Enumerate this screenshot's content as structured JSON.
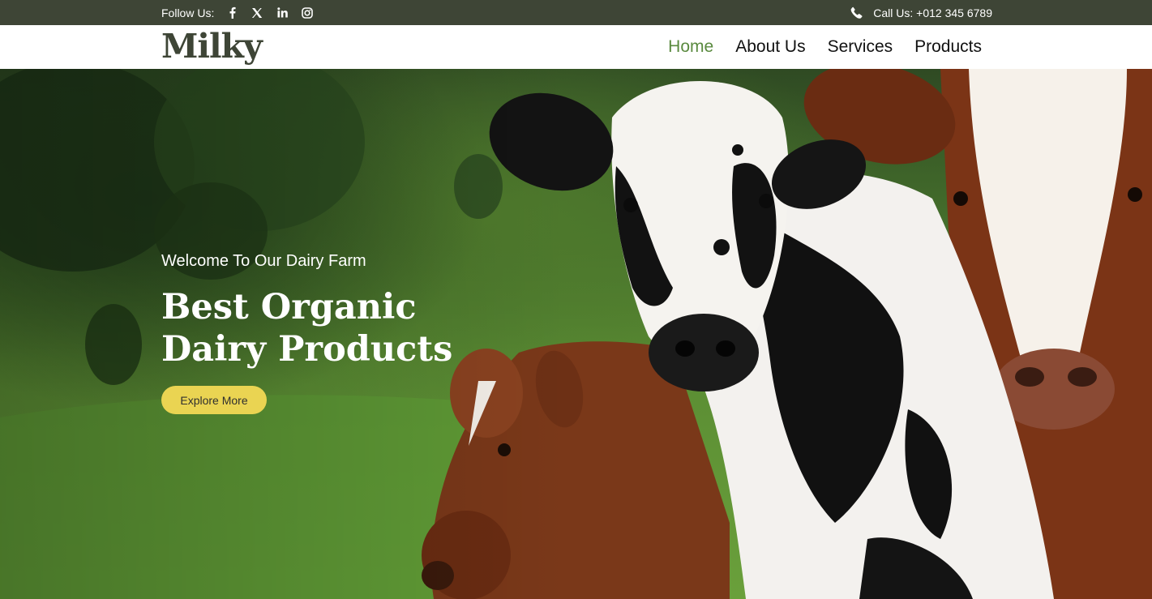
{
  "topbar": {
    "follow_label": "Follow Us:",
    "social_icons": [
      "facebook-icon",
      "x-icon",
      "linkedin-icon",
      "instagram-icon"
    ],
    "call_label": "Call Us: +012 345 6789",
    "background": "#3e4536"
  },
  "navbar": {
    "logo": "Milky",
    "items": [
      {
        "label": "Home",
        "active": true
      },
      {
        "label": "About Us",
        "active": false
      },
      {
        "label": "Services",
        "active": false
      },
      {
        "label": "Products",
        "active": false
      }
    ],
    "active_color": "#5a8a3f"
  },
  "hero": {
    "subtitle": "Welcome To Our Dairy Farm",
    "title_line1": "Best Organic",
    "title_line2": "Dairy Products",
    "button_label": "Explore More",
    "button_color": "#ead452"
  }
}
